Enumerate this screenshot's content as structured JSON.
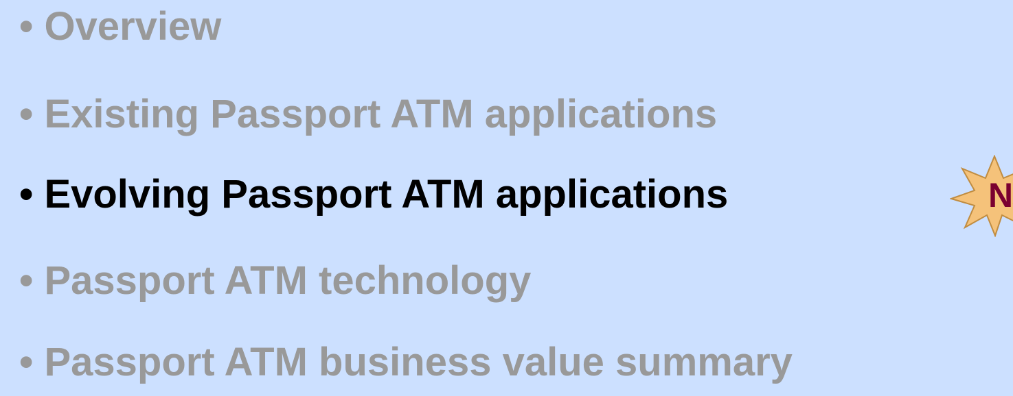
{
  "agenda": {
    "items": [
      {
        "bullet": "•",
        "label": "Overview"
      },
      {
        "bullet": "•",
        "label": "Existing Passport ATM applications"
      },
      {
        "bullet": "•",
        "label": "Evolving Passport ATM applications"
      },
      {
        "bullet": "•",
        "label": "Passport ATM technology"
      },
      {
        "bullet": "•",
        "label": "Passport ATM business value summary"
      }
    ],
    "active_index": 2,
    "badge": {
      "text": "N",
      "icon": "starburst-icon",
      "fill": "#f5c27a",
      "text_color": "#7a0030"
    }
  },
  "colors": {
    "background": "#cce0ff",
    "inactive_text": "#999999",
    "active_text": "#000000"
  }
}
